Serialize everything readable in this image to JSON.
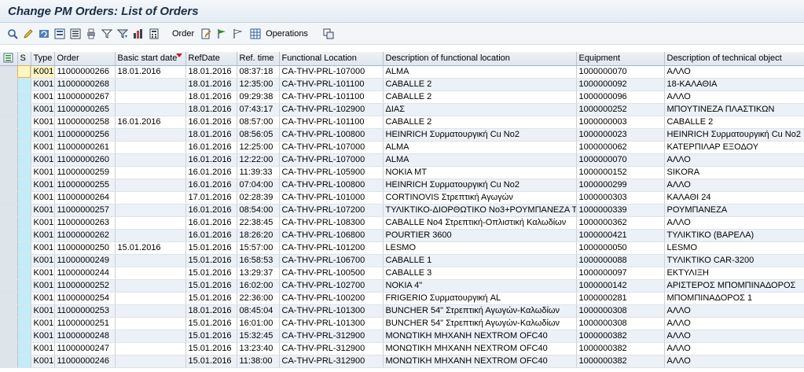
{
  "window": {
    "title": "Change PM Orders: List of Orders"
  },
  "toolbar": {
    "icons": [
      "details-icon",
      "edit-icon",
      "refresh-icon",
      "select-icon",
      "save-variant-icon",
      "print-icon",
      "filter-icon",
      "filter-down-icon",
      "abc-analysis-icon",
      "calculator-icon"
    ],
    "order_label": "Order",
    "operations_label": "Operations"
  },
  "table": {
    "columns": [
      "S",
      "Type",
      "Order",
      "Basic start date",
      "RefDate",
      "Ref. time",
      "Functional Location",
      "Description of functional location",
      "Equipment",
      "Description of technical object"
    ],
    "rows": [
      [
        "",
        "K001",
        "11000000266",
        "18.01.2016",
        "18.01.2016",
        "08:37:18",
        "CA-THV-PRL-107000",
        "ALMA",
        "1000000070",
        "ΑΛΛΟ"
      ],
      [
        "",
        "K001",
        "11000000268",
        "",
        "18.01.2016",
        "12:35:00",
        "CA-THV-PRL-101100",
        "CABALLE 2",
        "1000000092",
        "18-ΚΑΛΑΘΙΑ"
      ],
      [
        "",
        "K001",
        "11000000267",
        "",
        "18.01.2016",
        "09:29:38",
        "CA-THV-PRL-101100",
        "CABALLE 2",
        "1000000096",
        "ΑΛΛΟ"
      ],
      [
        "",
        "K001",
        "11000000265",
        "",
        "18.01.2016",
        "07:43:17",
        "CA-THV-PRL-102900",
        "ΔΙΑΣ",
        "1000000252",
        "ΜΠΟΥΤΙΝΕΖΑ ΠΛΑΣΤΙΚΩΝ"
      ],
      [
        "",
        "K001",
        "11000000258",
        "16.01.2016",
        "16.01.2016",
        "08:57:00",
        "CA-THV-PRL-101100",
        "CABALLE 2",
        "1000000003",
        "CABALLE 2"
      ],
      [
        "",
        "K001",
        "11000000256",
        "",
        "18.01.2016",
        "08:56:05",
        "CA-THV-PRL-100800",
        "HEINRICH Συρματουργική Cu No2",
        "1000000023",
        "HEINRICH Συρματουργική Cu No2"
      ],
      [
        "",
        "K001",
        "11000000261",
        "",
        "16.01.2016",
        "12:25:00",
        "CA-THV-PRL-107000",
        "ALMA",
        "1000000062",
        "ΚΑΤΕΡΠΙΛΑΡ ΕΞΟΔΟΥ"
      ],
      [
        "",
        "K001",
        "11000000260",
        "",
        "16.01.2016",
        "12:22:00",
        "CA-THV-PRL-107000",
        "ALMA",
        "1000000070",
        "ΑΛΛΟ"
      ],
      [
        "",
        "K001",
        "11000000259",
        "",
        "16.01.2016",
        "11:39:33",
        "CA-THV-PRL-105900",
        "NOKIA MT",
        "1000000152",
        "SIKORA"
      ],
      [
        "",
        "K001",
        "11000000255",
        "",
        "16.01.2016",
        "07:04:00",
        "CA-THV-PRL-100800",
        "HEINRICH Συρματουργική Cu No2",
        "1000000299",
        "ΑΛΛΟ"
      ],
      [
        "",
        "K001",
        "11000000264",
        "",
        "17.01.2016",
        "02:28:39",
        "CA-THV-PRL-101000",
        "CORTINOVIS Στρεπτική Αγωγών",
        "1000000303",
        "ΚΑΛΑΘΙ 24"
      ],
      [
        "",
        "K001",
        "11000000257",
        "",
        "16.01.2016",
        "08:54:00",
        "CA-THV-PRL-107200",
        "ΤΥΛΙΚΤΙΚΟ-ΔΙΟΡΘΩΤΙΚΟ No3+ΡΟΥΜΠΑΝΕΖΑ ΤΑ...",
        "1000000339",
        "ΡΟΥΜΠΑΝΕΖΑ"
      ],
      [
        "",
        "K001",
        "11000000263",
        "",
        "16.01.2016",
        "22:38:45",
        "CA-THV-PRL-108300",
        "CABALLE No4 Στρεπτική-Οπλιστική Καλωδίων",
        "1000000362",
        "ΑΛΛΟ"
      ],
      [
        "",
        "K001",
        "11000000262",
        "",
        "16.01.2016",
        "18:26:20",
        "CA-THV-PRL-106800",
        "POURTIER 3600",
        "1000000421",
        "ΤΥΛΙΚΤΙΚΟ (ΒΑΡΕΛΑ)"
      ],
      [
        "",
        "K001",
        "11000000250",
        "15.01.2016",
        "15.01.2016",
        "15:57:00",
        "CA-THV-PRL-101200",
        "LESMO",
        "1000000050",
        "LESMO"
      ],
      [
        "",
        "K001",
        "11000000249",
        "",
        "15.01.2016",
        "16:58:53",
        "CA-THV-PRL-106700",
        "CABALLE 1",
        "1000000088",
        "ΤΥΛΙΚΤΙΚΟ CAR-3200"
      ],
      [
        "",
        "K001",
        "11000000244",
        "",
        "15.01.2016",
        "13:29:37",
        "CA-THV-PRL-100500",
        "CABALLE 3",
        "1000000097",
        "ΕΚΤΥΛΙΞΗ"
      ],
      [
        "",
        "K001",
        "11000000252",
        "",
        "15.01.2016",
        "16:02:00",
        "CA-THV-PRL-102700",
        "NOKIA 4\"",
        "1000000142",
        "ΑΡΙΣΤΕΡΟΣ ΜΠΟΜΠΙΝΑΔΟΡΟΣ"
      ],
      [
        "",
        "K001",
        "11000000254",
        "",
        "15.01.2016",
        "22:36:00",
        "CA-THV-PRL-100200",
        "FRIGERIO Συρματουργική AL",
        "1000000281",
        "ΜΠΟΜΠΙΝΑΔΟΡΟΣ 1"
      ],
      [
        "",
        "K001",
        "11000000253",
        "",
        "18.01.2016",
        "08:45:04",
        "CA-THV-PRL-101300",
        "BUNCHER 54\" Στρεπτική Αγωγών-Καλωδίων",
        "1000000308",
        "ΑΛΛΟ"
      ],
      [
        "",
        "K001",
        "11000000251",
        "",
        "15.01.2016",
        "16:01:00",
        "CA-THV-PRL-101300",
        "BUNCHER 54\" Στρεπτική Αγωγών-Καλωδίων",
        "1000000308",
        "ΑΛΛΟ"
      ],
      [
        "",
        "K001",
        "11000000248",
        "",
        "15.01.2016",
        "15:32:45",
        "CA-THV-PRL-312900",
        "ΜΟΝΩΤΙΚΗ ΜΗΧΑΝΗ NEXTROM OFC40",
        "1000000382",
        "ΑΛΛΟ"
      ],
      [
        "",
        "K001",
        "11000000247",
        "",
        "15.01.2016",
        "13:23:40",
        "CA-THV-PRL-312900",
        "ΜΟΝΩΤΙΚΗ ΜΗΧΑΝΗ NEXTROM OFC40",
        "1000000382",
        "ΑΛΛΟ"
      ],
      [
        "",
        "K001",
        "11000000246",
        "",
        "15.01.2016",
        "11:38:00",
        "CA-THV-PRL-312900",
        "ΜΟΝΩΤΙΚΗ ΜΗΧΑΝΗ NEXTROM OFC40",
        "1000000382",
        "ΑΛΛΟ"
      ]
    ]
  },
  "colors": {
    "row_even": "#ecf1f7",
    "status_column": "#c4ecf7",
    "sort_marker": "#d01818"
  }
}
